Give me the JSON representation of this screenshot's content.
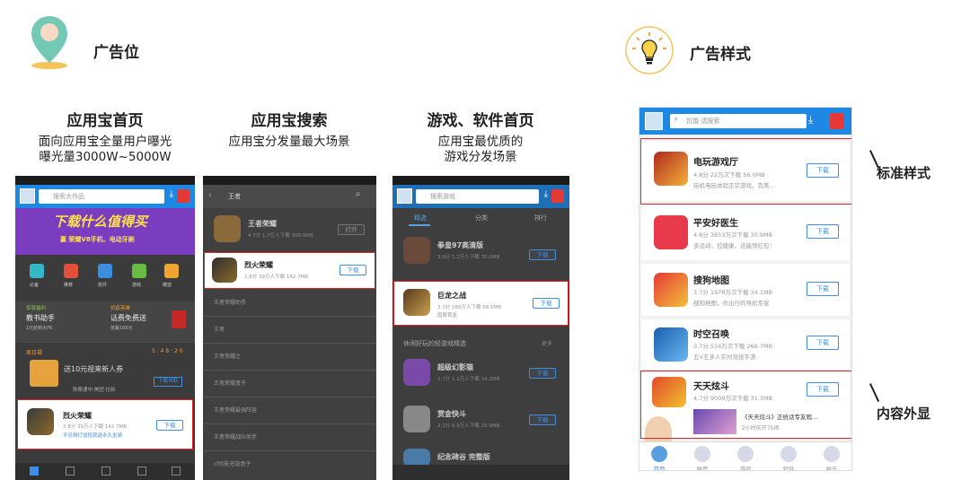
{
  "left_section": {
    "title": "广告位",
    "icon": "map-pin-icon"
  },
  "right_section": {
    "title": "广告样式",
    "icon": "lightbulb-icon"
  },
  "columns": [
    {
      "title": "应用宝首页",
      "sub1": "面向应用宝全量用户曝光",
      "sub2": "曝光量3000W~5000W"
    },
    {
      "title": "应用宝搜索",
      "sub1": "应用宝分发量最大场景",
      "sub2": ""
    },
    {
      "title": "游戏、软件首页",
      "sub1": "应用宝最优质的",
      "sub2": "游戏分发场景"
    }
  ],
  "phone1": {
    "search_placeholder": "搜索大作品",
    "banner_text": "下载什么值得买",
    "banner_sub": "赢 荣耀V8手机、电动牙刷",
    "icons": [
      "必备",
      "推荐",
      "软件",
      "游戏",
      "精选"
    ],
    "promo_left_title": "惊喜福利",
    "promo_left": "教书助手",
    "promo_left_sub": "1元抢到大PK",
    "promo_right_title": "抗疫英雄",
    "promo_right": "话费免费送",
    "promo_right_sub": "抢赢100元",
    "section_label": "周日福",
    "section_right": "5 : 4 8 : 2 0",
    "coupon_title": "送10元视来新人券",
    "coupon_sub": "购票通中·美团·拉新",
    "coupon_btn": "下载领取",
    "ad_name": "烈火荣耀",
    "ad_meta": "2.8分  39万人下载  142.7MB",
    "ad_desc": "不见倒打冒险就送永久坐骑",
    "ad_btn": "下载"
  },
  "phone2": {
    "search_text": "王者",
    "first_name": "王者荣耀",
    "first_meta": "4.7分  1.7亿人下载  308.9MB",
    "first_btn": "打开",
    "ad_name": "烈火荣耀",
    "ad_meta": "2.8分  39万人下载  142.7MB",
    "ad_btn": "下载",
    "suggestions": [
      "王者荣耀助手",
      "王者",
      "王者荣耀之",
      "王者荣耀盒子",
      "王者荣耀最强阵容",
      "王者荣耀战队助手",
      "cf也能无敌盒子"
    ]
  },
  "phone3": {
    "search_placeholder": "搜索游戏",
    "tabs": [
      "精选",
      "分类",
      "排行"
    ],
    "g1_name": "拳皇97高清版",
    "g1_meta": "3.9分  1.2万人下载  70.0MB",
    "g1_btn": "下载",
    "ad_name": "巨龙之战",
    "ad_meta": "3.7分  189万人下载  68.5MB",
    "ad_desc": "国服首发",
    "ad_btn": "下载",
    "section_label": "休闲好玩的轻游戏精选",
    "section_more": "更多",
    "g2_name": "超级幻影猫",
    "g2_meta": "2.7分  1.1万人下载  34.2MB",
    "g2_btn": "下载",
    "g3_name": "赏金快斗",
    "g3_meta": "2.2分  6.9万人下载  25.9MB",
    "g3_btn": "下载",
    "g4_name": "纪念碑谷 完整版"
  },
  "bigphone": {
    "search_placeholder": "饥饿·请搜索",
    "cards": [
      {
        "name": "电玩游戏厅",
        "meta": "4.8分  22万次下载  56.0MB",
        "desc": "街机电玩体验正宗游戏，完美...",
        "btn": "下载"
      },
      {
        "name": "平安好医生",
        "meta": "4.6分  3853万次下载  30.9MB",
        "desc": "多运动，控健康，还能领红包！",
        "btn": "下载"
      },
      {
        "name": "搜狗地图",
        "meta": "3.7分  1978万次下载  34.1MB",
        "desc": "搜狗地图，你出行的导航专家",
        "btn": "下载"
      },
      {
        "name": "时空召唤",
        "meta": "3.7分  516万次下载  268.7MB",
        "desc": "五V五多人实时竞技手游",
        "btn": "下载"
      },
      {
        "name": "天天炫斗",
        "meta": "4.7分  9009万次下载  31.3MB",
        "desc": "",
        "btn": "下载"
      }
    ],
    "content_title": "《天天炫斗》正统话专友观...",
    "content_time": "2小时前开75场",
    "tabs": [
      "首页",
      "推荐",
      "游戏",
      "软件",
      "娱乐"
    ]
  },
  "callouts": {
    "standard": "标准样式",
    "content": "内容外显"
  },
  "colors": {
    "accent": "#1e88e5",
    "frame": "#e02424",
    "download": "#3d8ee6"
  }
}
